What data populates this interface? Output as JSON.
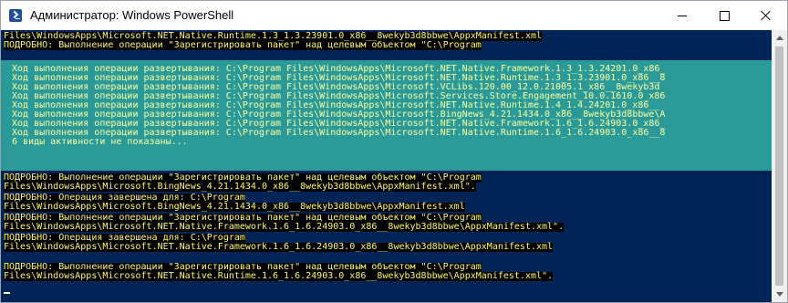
{
  "window": {
    "title": "Администратор: Windows PowerShell",
    "icon": "powershell-icon"
  },
  "controls": {
    "minimize_icon": "minimize-icon",
    "maximize_icon": "maximize-icon",
    "close_icon": "close-icon"
  },
  "colors": {
    "console_background": "#012456",
    "progress_background": "#2a9a98",
    "verbose_text": "#fffa63",
    "progress_text": "#ffff9e"
  },
  "console": {
    "top_lines": [
      "Files\\WindowsApps\\Microsoft.NET.Native.Runtime.1.3_1.3.23901.0_x86__8wekyb3d8bbwe\\AppxManifest.xml",
      "ПОДРОБНО: Выполнение операции \"Зарегистрировать пакет\" над целевым объектом \"C:\\Program"
    ],
    "progress": [
      "Ход выполнения операции развертывания: C:\\Program Files\\WindowsApps\\Microsoft.NET.Native.Framework.1.3_1.3.24201.0_x86_",
      "Ход выполнения операции развертывания: C:\\Program Files\\WindowsApps\\Microsoft.NET.Native.Runtime.1.3_1.3.23901.0_x86__8",
      "Ход выполнения операции развертывания: C:\\Program Files\\WindowsApps\\Microsoft.VCLibs.120.00_12.0.21005.1_x86__8wekyb3d",
      "Ход выполнения операции развертывания: C:\\Program Files\\WindowsApps\\Microsoft.Services.Store.Engagement_10.0.1610.0_x86",
      "Ход выполнения операции развертывания: C:\\Program Files\\WindowsApps\\Microsoft.NET.Native.Runtime.1.4_1.4.24201.0_x86__",
      "Ход выполнения операции развертывания: C:\\Program Files\\WindowsApps\\Microsoft.BingNews_4.21.1434.0_x86__8wekyb3d8bbwe\\A",
      "Ход выполнения операции развертывания: C:\\Program Files\\WindowsApps\\Microsoft.NET.Native.Framework.1.6_1.6.24903.0_x86_",
      "Ход выполнения операции развертывания: C:\\Program Files\\WindowsApps\\Microsoft.NET.Native.Runtime.1.6_1.6.24903.0_x86__8",
      "6 виды активности не показаны..."
    ],
    "bottom_lines": [
      "ПОДРОБНО: Выполнение операции \"Зарегистрировать пакет\" над целевым объектом \"C:\\Program",
      "Files\\WindowsApps\\Microsoft.BingNews_4.21.1434.0_x86__8wekyb3d8bbwe\\AppxManifest.xml\".",
      "ПОДРОБНО: Операция завершена для: C:\\Program",
      "Files\\WindowsApps\\Microsoft.BingNews_4.21.1434.0_x86__8wekyb3d8bbwe\\AppxManifest.xml",
      "ПОДРОБНО: Выполнение операции \"Зарегистрировать пакет\" над целевым объектом \"C:\\Program",
      "Files\\WindowsApps\\Microsoft.NET.Native.Framework.1.6_1.6.24903.0_x86__8wekyb3d8bbwe\\AppxManifest.xml\".",
      "ПОДРОБНО: Операция завершена для: C:\\Program",
      "Files\\WindowsApps\\Microsoft.NET.Native.Framework.1.6_1.6.24903.0_x86__8wekyb3d8bbwe\\AppxManifest.xml",
      "ПОДРОБНО: Выполнение операции \"Зарегистрировать пакет\" над целевым объектом \"C:\\Program",
      "Files\\WindowsApps\\Microsoft.NET.Native.Runtime.1.6_1.6.24903.0_x86__8wekyb3d8bbwe\\AppxManifest.xml\"."
    ]
  },
  "scrollbar": {
    "up_icon": "scroll-up-arrow-icon",
    "down_icon": "scroll-down-arrow-icon"
  }
}
